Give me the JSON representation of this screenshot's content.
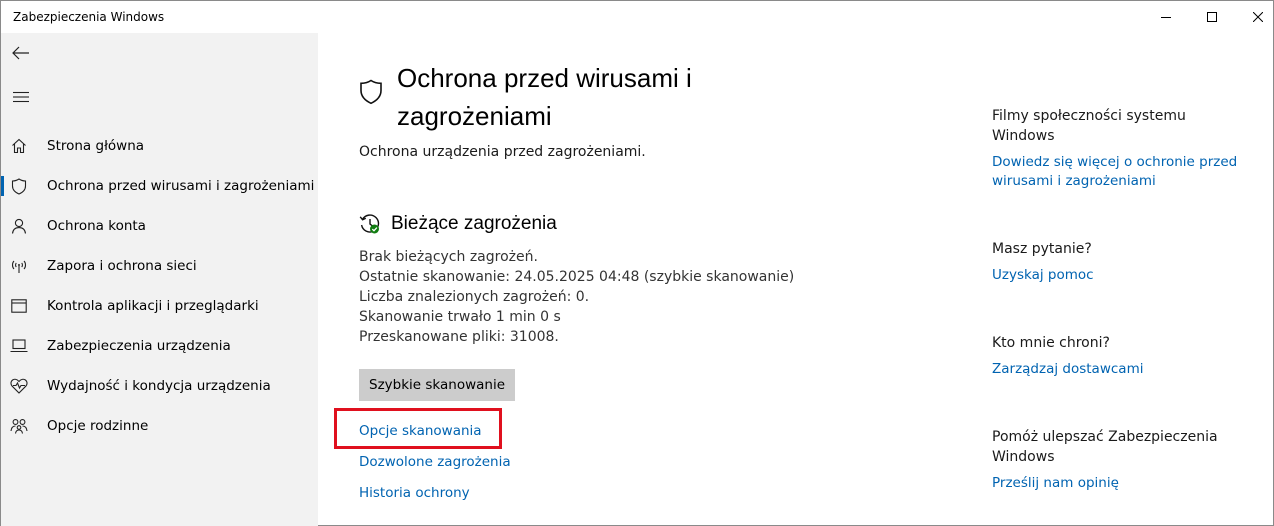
{
  "window": {
    "title": "Zabezpieczenia Windows"
  },
  "sidebar": {
    "items": [
      {
        "label": "Strona główna",
        "icon": "home-icon"
      },
      {
        "label": "Ochrona przed wirusami i zagrożeniami",
        "icon": "shield-icon",
        "active": true
      },
      {
        "label": "Ochrona konta",
        "icon": "person-icon"
      },
      {
        "label": "Zapora i ochrona sieci",
        "icon": "wifi-antenna-icon"
      },
      {
        "label": "Kontrola aplikacji i przeglądarki",
        "icon": "browser-window-icon"
      },
      {
        "label": "Zabezpieczenia urządzenia",
        "icon": "laptop-icon"
      },
      {
        "label": "Wydajność i kondycja urządzenia",
        "icon": "heart-pulse-icon"
      },
      {
        "label": "Opcje rodzinne",
        "icon": "family-icon"
      }
    ]
  },
  "main": {
    "title": "Ochrona przed wirusami i zagrożeniami",
    "subtitle": "Ochrona urządzenia przed zagrożeniami.",
    "current_threats": {
      "title": "Bieżące zagrożenia",
      "lines": [
        "Brak bieżących zagrożeń.",
        "Ostatnie skanowanie: 24.05.2025 04:48 (szybkie skanowanie)",
        "Liczba znalezionych zagrożeń: 0.",
        "Skanowanie trwało 1 min 0 s",
        "Przeskanowane pliki: 31008."
      ],
      "quick_scan_label": "Szybkie skanowanie",
      "links": {
        "scan_options": "Opcje skanowania",
        "allowed_threats": "Dozwolone zagrożenia",
        "protection_history": "Historia ochrony"
      }
    }
  },
  "right": {
    "groups": [
      {
        "heading": "Filmy społeczności systemu Windows",
        "link": "Dowiedz się więcej o ochronie przed wirusami i zagrożeniami"
      },
      {
        "heading": "Masz pytanie?",
        "link": "Uzyskaj pomoc"
      },
      {
        "heading": "Kto mnie chroni?",
        "link": "Zarządzaj dostawcami"
      },
      {
        "heading": "Pomóż ulepszać Zabezpieczenia Windows",
        "link": "Prześlij nam opinię"
      }
    ]
  },
  "colors": {
    "accent": "#0063b1",
    "highlight": "#e0101e",
    "sidebar_bg": "#f2f2f2"
  }
}
